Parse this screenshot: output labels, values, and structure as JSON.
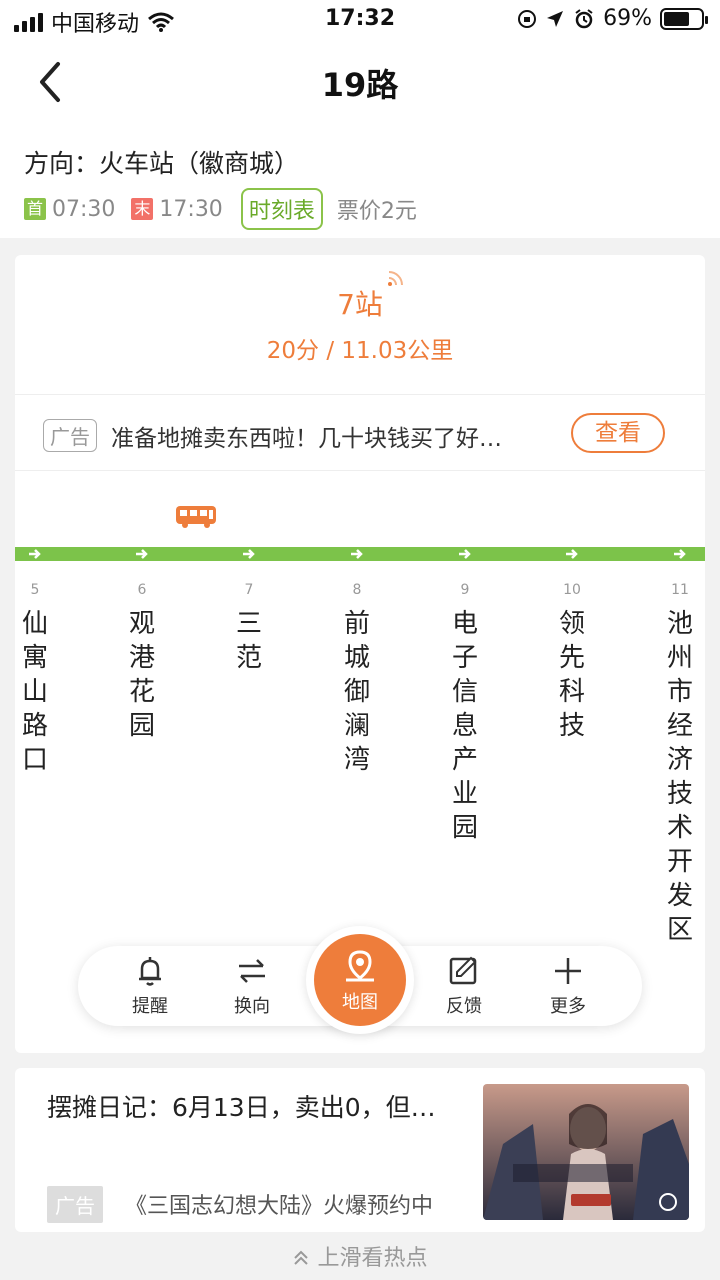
{
  "status_bar": {
    "carrier": "中国移动",
    "time": "17:32",
    "battery": "69%",
    "battery_level": 0.69
  },
  "nav": {
    "title": "19路"
  },
  "route_info": {
    "direction": "方向：火车站（徽商城）",
    "first_tag": "首",
    "first_time": "07:30",
    "last_tag": "末",
    "last_time": "17:30",
    "timetable_label": "时刻表",
    "fare": "票价2元"
  },
  "arrival": {
    "stops": "7站",
    "eta": "20分 / 11.03公里"
  },
  "ad_banner": {
    "badge": "广告",
    "text": "准备地摊卖东西啦！几十块钱买了好…",
    "button": "查看"
  },
  "stations": [
    {
      "num": "5",
      "name": "仙寓山路口"
    },
    {
      "num": "6",
      "name": "观港花园"
    },
    {
      "num": "7",
      "name": "三范"
    },
    {
      "num": "8",
      "name": "前城御澜湾"
    },
    {
      "num": "9",
      "name": "电子信息产业园"
    },
    {
      "num": "10",
      "name": "领先科技"
    },
    {
      "num": "11",
      "name": "池州市经济技术开发区"
    }
  ],
  "toolbar": {
    "remind": "提醒",
    "switch": "换向",
    "map": "地图",
    "feedback": "反馈",
    "more": "更多"
  },
  "news": {
    "title": "摆摊日记：6月13日，卖出0，但…",
    "ad_badge": "广告",
    "subtitle": "《三国志幻想大陆》火爆预约中"
  },
  "hint": "上滑看热点",
  "colors": {
    "accent": "#ee7d3b",
    "route_green": "#7cc34a"
  }
}
